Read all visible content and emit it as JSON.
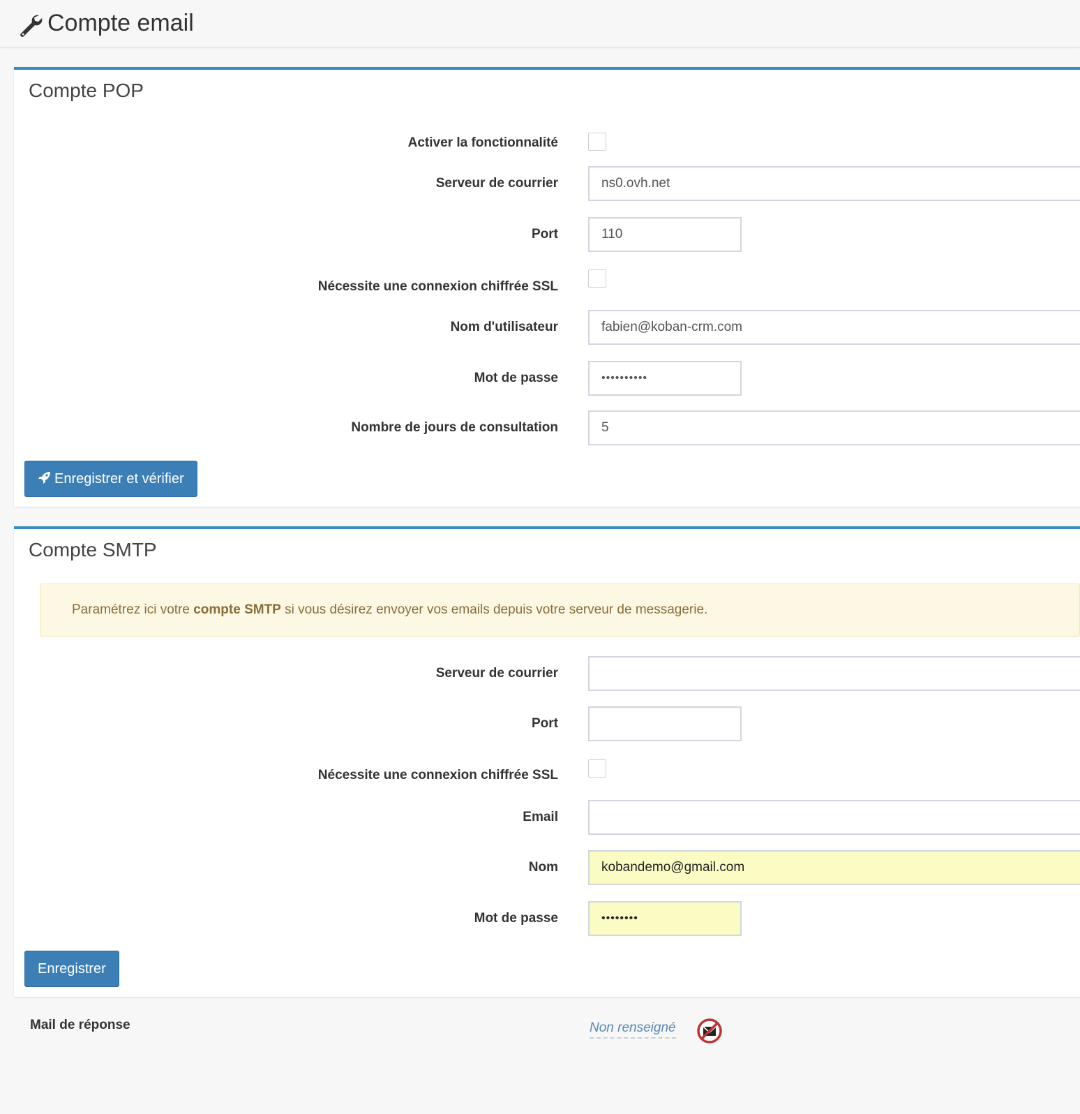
{
  "header": {
    "title": "Compte email",
    "icon": "wrench-icon"
  },
  "pop": {
    "title": "Compte POP",
    "enable_label": "Activer la fonctionnalité",
    "enable_checked": false,
    "server_label": "Serveur de courrier",
    "server_value": "ns0.ovh.net",
    "port_label": "Port",
    "port_value": "110",
    "ssl_label": "Nécessite une connexion chiffrée SSL",
    "ssl_checked": false,
    "username_label": "Nom d'utilisateur",
    "username_value": "fabien@koban-crm.com",
    "password_label": "Mot de passe",
    "password_value": "••••••••••",
    "days_label": "Nombre de jours de consultation",
    "days_value": "5",
    "save_button_label": "Enregistrer et vérifier",
    "save_button_icon": "rocket-icon"
  },
  "smtp": {
    "title": "Compte SMTP",
    "info_prefix": "Paramétrez ici votre ",
    "info_bold": "compte SMTP",
    "info_suffix": " si vous désirez envoyer vos emails depuis votre serveur de messagerie.",
    "server_label": "Serveur de courrier",
    "server_value": "",
    "port_label": "Port",
    "port_value": "",
    "ssl_label": "Nécessite une connexion chiffrée SSL",
    "ssl_checked": false,
    "email_label": "Email",
    "email_value": "",
    "name_label": "Nom",
    "name_value": "kobandemo@gmail.com",
    "password_label": "Mot de passe",
    "password_value": "••••••••",
    "save_button_label": "Enregistrer"
  },
  "reply": {
    "label": "Mail de réponse",
    "value": "Non renseigné",
    "icon": "no-mail-icon"
  },
  "colors": {
    "accent": "#3c8dbc",
    "button": "#3c7fb7",
    "callout_bg": "#fcf8e3",
    "callout_text": "#8a6d3b",
    "autofill": "#fafcc4"
  }
}
